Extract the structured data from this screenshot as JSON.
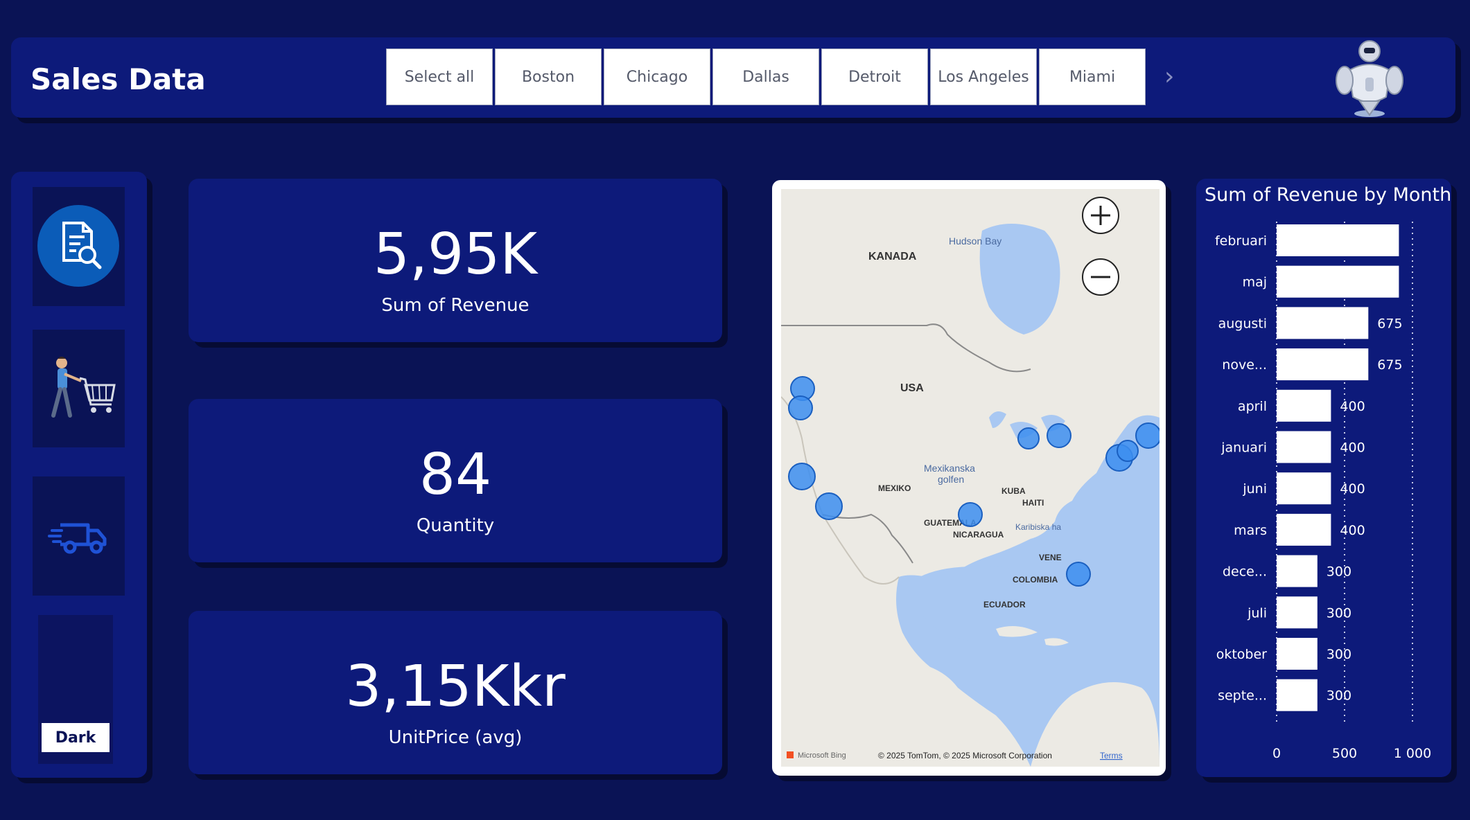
{
  "header": {
    "title": "Sales Data",
    "slicer": [
      "Select all",
      "Boston",
      "Chicago",
      "Dallas",
      "Detroit",
      "Los Angeles",
      "Miami"
    ],
    "next_icon": "chevron-right-icon"
  },
  "nav": {
    "report_icon": "report-search-icon",
    "shop_icon": "shopping-cart-icon",
    "truck_icon": "delivery-truck-icon",
    "theme_button": "Dark"
  },
  "kpis": [
    {
      "value": "5,95K",
      "label": "Sum of Revenue"
    },
    {
      "value": "84",
      "label": "Quantity"
    },
    {
      "value": "3,15Kkr",
      "label": "UnitPrice (avg)"
    }
  ],
  "map": {
    "labels": {
      "kanada": "KANADA",
      "hudson": "Hudson Bay",
      "usa": "USA",
      "gulf1": "Mexikanska",
      "gulf2": "golfen",
      "mexiko": "MEXIKO",
      "kuba": "KUBA",
      "haiti": "HAITI",
      "guatemala": "GUATEMALA",
      "nicaragua": "NICARAGUA",
      "karibiska": "Karibiska ha",
      "vene": "VENE",
      "colombia": "COLOMBIA",
      "ecuador": "ECUADOR"
    },
    "attribution": "© 2025 TomTom, © 2025 Microsoft Corporation",
    "terms": "Terms",
    "bing": "Microsoft Bing",
    "zoom_in": "+",
    "zoom_out": "−"
  },
  "chart_data": {
    "type": "bar",
    "orientation": "horizontal",
    "title": "Sum of Revenue by Month",
    "categories": [
      "februari",
      "maj",
      "augusti",
      "nove...",
      "april",
      "januari",
      "juni",
      "mars",
      "dece...",
      "juli",
      "oktober",
      "septe..."
    ],
    "values": [
      900,
      900,
      675,
      675,
      400,
      400,
      400,
      400,
      300,
      300,
      300,
      300
    ],
    "data_labels": [
      "",
      "",
      "675",
      "675",
      "400",
      "400",
      "400",
      "400",
      "300",
      "300",
      "300",
      "300"
    ],
    "xlim": [
      0,
      1000
    ],
    "xticks": [
      "0",
      "500",
      "1 000"
    ],
    "bar_color": "#ffffff",
    "grid": true
  },
  "colors": {
    "background": "#0a1355",
    "panel": "#0d1a7a",
    "accent": "#0b5cb8",
    "marker": "#3d8ef0"
  }
}
